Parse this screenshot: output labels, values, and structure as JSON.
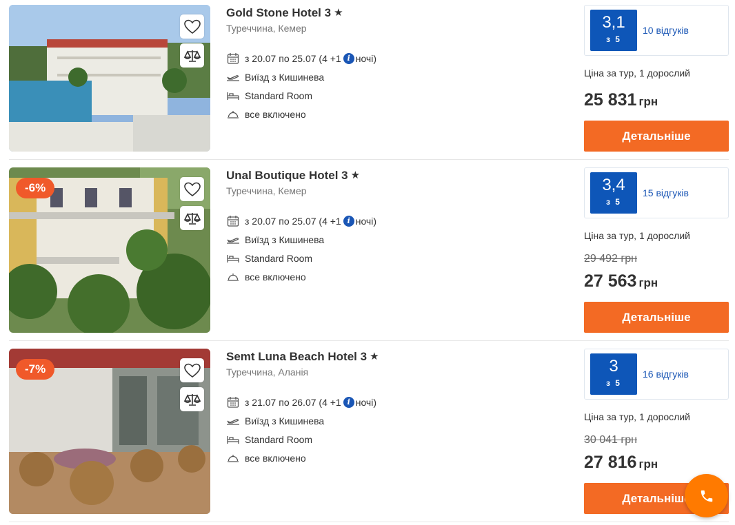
{
  "colors": {
    "accent": "#f36a24",
    "rating_bg": "#0e56b8",
    "discount_bg": "#f0592a",
    "link": "#1a56b5"
  },
  "hotels": [
    {
      "name": "Gold Stone Hotel 3",
      "location": "Туреччина, Кемер",
      "dates_prefix": "з 20.07 по 25.07 (4 +1",
      "dates_suffix": "ночі)",
      "departure": "Виїзд з Кишинева",
      "room": "Standard Room",
      "meal": "все включено",
      "rating": "3,1",
      "rating_of": "з 5",
      "reviews": "10 відгуків",
      "price_label": "Ціна за тур, 1 дорослий",
      "old_price": "",
      "price": "25 831",
      "currency": "грн",
      "discount": "",
      "button": "Детальніше"
    },
    {
      "name": "Unal Boutique Hotel 3",
      "location": "Туреччина, Кемер",
      "dates_prefix": "з 20.07 по 25.07 (4 +1",
      "dates_suffix": "ночі)",
      "departure": "Виїзд з Кишинева",
      "room": "Standard Room",
      "meal": "все включено",
      "rating": "3,4",
      "rating_of": "з 5",
      "reviews": "15 відгуків",
      "price_label": "Ціна за тур, 1 дорослий",
      "old_price": "29 492 грн",
      "price": "27 563",
      "currency": "грн",
      "discount": "-6%",
      "button": "Детальніше"
    },
    {
      "name": "Semt Luna Beach Hotel 3",
      "location": "Туреччина, Аланія",
      "dates_prefix": "з 21.07 по 26.07 (4 +1",
      "dates_suffix": "ночі)",
      "departure": "Виїзд з Кишинева",
      "room": "Standard Room",
      "meal": "все включено",
      "rating": "3",
      "rating_of": "з 5",
      "reviews": "16 відгуків",
      "price_label": "Ціна за тур, 1 дорослий",
      "old_price": "30 041 грн",
      "price": "27 816",
      "currency": "грн",
      "discount": "-7%",
      "button": "Детальніше"
    }
  ],
  "icons": [
    "heart-icon",
    "compare-scales-icon",
    "calendar-icon",
    "plane-icon",
    "bed-icon",
    "food-cloche-icon",
    "info-icon",
    "star-icon",
    "phone-icon"
  ]
}
